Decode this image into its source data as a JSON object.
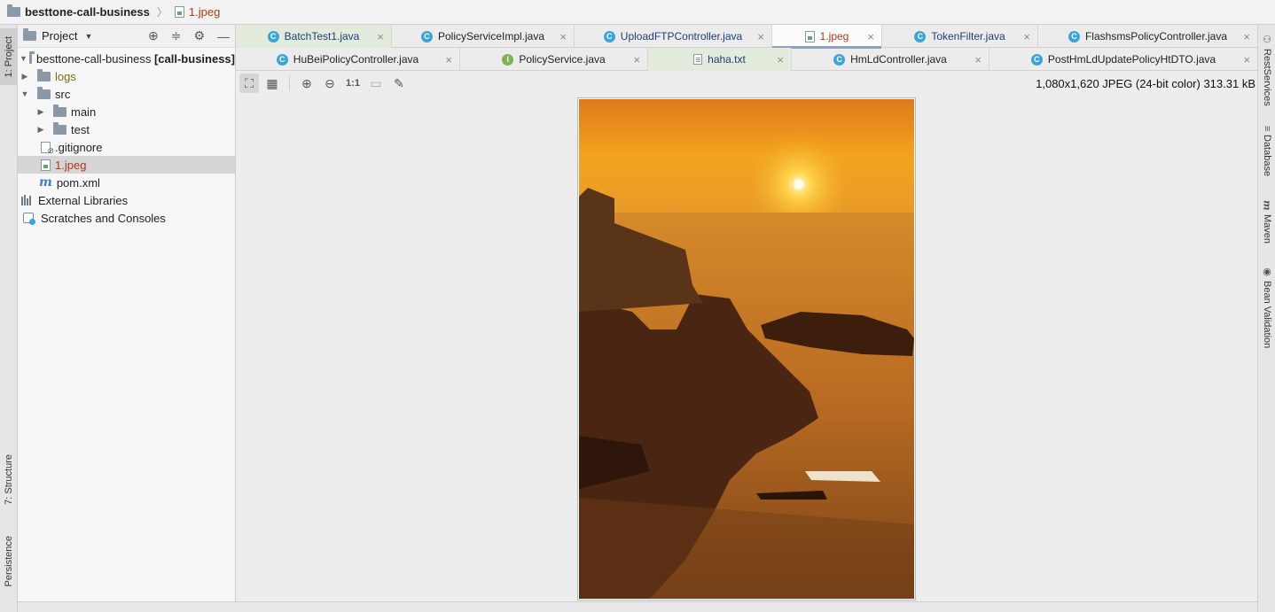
{
  "breadcrumb": {
    "project": "besttone-call-business",
    "file": "1.jpeg"
  },
  "left_stripe": {
    "tabs": [
      "1: Project",
      "7: Structure",
      "Persistence"
    ]
  },
  "project_panel": {
    "title": "Project",
    "tree": {
      "root_name": "besttone-call-business",
      "root_module": "[call-business]",
      "logs": "logs",
      "src": "src",
      "main": "main",
      "test": "test",
      "gitignore": ".gitignore",
      "jpeg": "1.jpeg",
      "pom": "pom.xml",
      "external": "External Libraries",
      "scratches": "Scratches and Consoles"
    }
  },
  "tabs_row1": [
    {
      "label": "BatchTest1.java"
    },
    {
      "label": "PolicyServiceImpl.java"
    },
    {
      "label": "UploadFTPController.java"
    },
    {
      "label": "1.jpeg"
    },
    {
      "label": "TokenFilter.java"
    },
    {
      "label": "FlashsmsPolicyController.java"
    }
  ],
  "tabs_row2": [
    {
      "label": "HuBeiPolicyController.java"
    },
    {
      "label": "PolicyService.java"
    },
    {
      "label": "haha.txt"
    },
    {
      "label": "HmLdController.java"
    },
    {
      "label": "PostHmLdUpdatePolicyHtDTO.java"
    }
  ],
  "image_toolbar": {
    "actual_size": "1:1",
    "info": "1,080x1,620 JPEG (24-bit color) 313.31 kB"
  },
  "right_stripe": {
    "tabs": [
      "RestServices",
      "Database",
      "Maven",
      "Bean Validation"
    ]
  },
  "colors": {
    "accent": "#8fa1ba",
    "file_red": "#b03a1a",
    "class_blue": "#3ba5d8"
  }
}
